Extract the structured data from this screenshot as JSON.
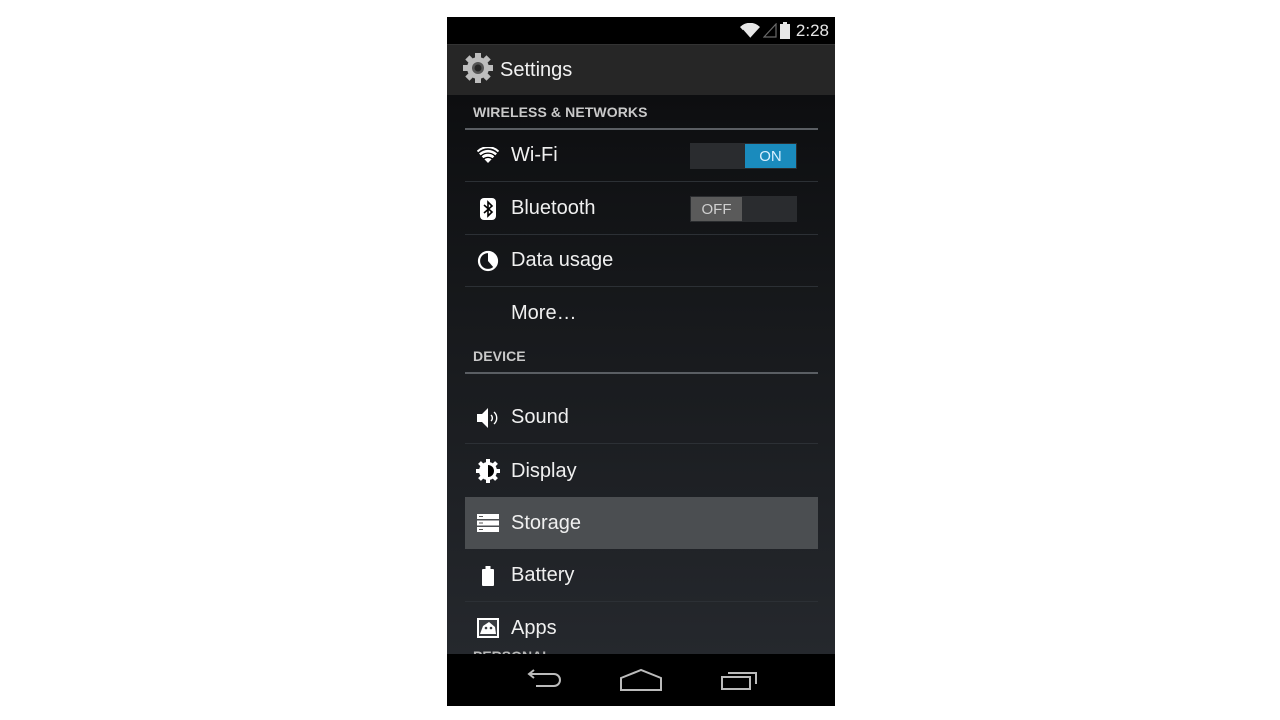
{
  "status_bar": {
    "time": "2:28",
    "icons": [
      "wifi-icon",
      "cell-signal-icon",
      "battery-icon"
    ]
  },
  "action_bar": {
    "title": "Settings",
    "icon": "settings-gear-icon"
  },
  "sections": [
    {
      "header": "WIRELESS & NETWORKS",
      "items": [
        {
          "label": "Wi-Fi",
          "icon": "wifi-icon",
          "toggle": "ON",
          "toggle_state": true
        },
        {
          "label": "Bluetooth",
          "icon": "bluetooth-icon",
          "toggle": "OFF",
          "toggle_state": false
        },
        {
          "label": "Data usage",
          "icon": "data-usage-icon"
        },
        {
          "label": "More…",
          "icon": null
        }
      ]
    },
    {
      "header": "DEVICE",
      "items": [
        {
          "label": "Sound",
          "icon": "sound-icon"
        },
        {
          "label": "Display",
          "icon": "display-brightness-icon"
        },
        {
          "label": "Storage",
          "icon": "storage-icon",
          "selected": true
        },
        {
          "label": "Battery",
          "icon": "battery-icon"
        },
        {
          "label": "Apps",
          "icon": "apps-icon"
        }
      ]
    },
    {
      "header": "PERSONAL",
      "items": []
    }
  ],
  "nav_bar": {
    "buttons": [
      "back",
      "home",
      "recent-apps"
    ]
  },
  "colors": {
    "toggle_on": "#1a8bbd",
    "toggle_off": "#5a5a5a",
    "selected_row": "#4b4e51",
    "action_bar": "#262626"
  }
}
